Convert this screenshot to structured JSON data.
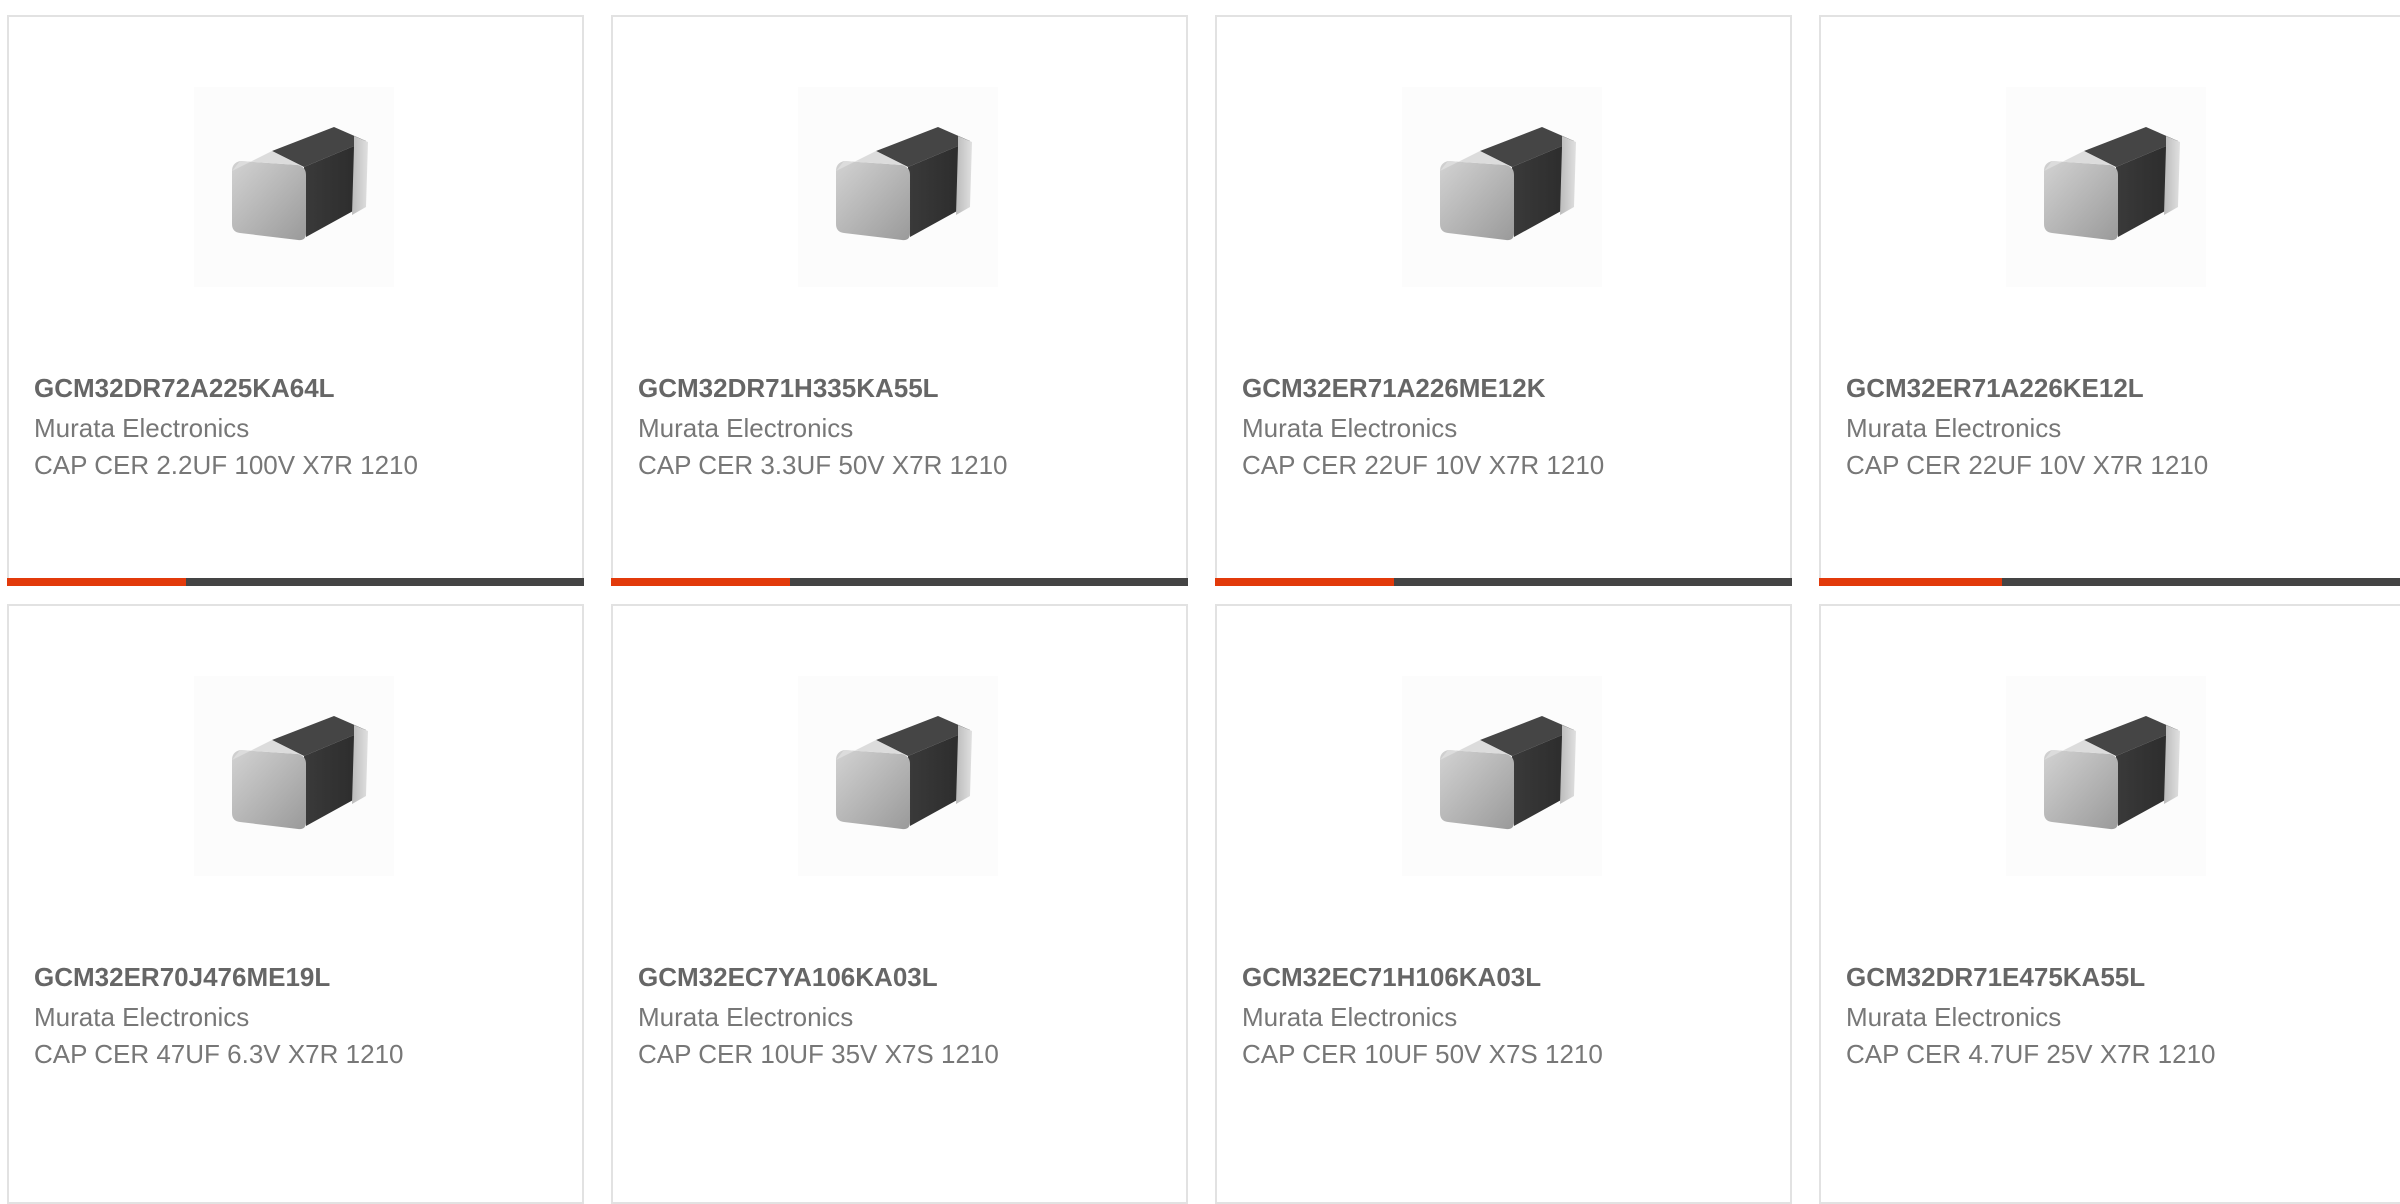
{
  "accent_color": "#e23a0b",
  "bar_track_color": "#444444",
  "products": [
    {
      "part_number": "GCM32DR72A225KA64L",
      "manufacturer": "Murata Electronics",
      "description": "CAP CER 2.2UF 100V X7R 1210",
      "image_icon": "ceramic-capacitor-chip-icon",
      "bar_fill_fraction": 0.31
    },
    {
      "part_number": "GCM32DR71H335KA55L",
      "manufacturer": "Murata Electronics",
      "description": "CAP CER 3.3UF 50V X7R 1210",
      "image_icon": "ceramic-capacitor-chip-icon",
      "bar_fill_fraction": 0.31
    },
    {
      "part_number": "GCM32ER71A226ME12K",
      "manufacturer": "Murata Electronics",
      "description": "CAP CER 22UF 10V X7R 1210",
      "image_icon": "ceramic-capacitor-chip-icon",
      "bar_fill_fraction": 0.31
    },
    {
      "part_number": "GCM32ER71A226KE12L",
      "manufacturer": "Murata Electronics",
      "description": "CAP CER 22UF 10V X7R 1210",
      "image_icon": "ceramic-capacitor-chip-icon",
      "bar_fill_fraction": 0.31
    },
    {
      "part_number": "GCM32ER70J476ME19L",
      "manufacturer": "Murata Electronics",
      "description": "CAP CER 47UF 6.3V X7R 1210",
      "image_icon": "ceramic-capacitor-chip-icon"
    },
    {
      "part_number": "GCM32EC7YA106KA03L",
      "manufacturer": "Murata Electronics",
      "description": "CAP CER 10UF 35V X7S 1210",
      "image_icon": "ceramic-capacitor-chip-icon"
    },
    {
      "part_number": "GCM32EC71H106KA03L",
      "manufacturer": "Murata Electronics",
      "description": "CAP CER 10UF 50V X7S 1210",
      "image_icon": "ceramic-capacitor-chip-icon"
    },
    {
      "part_number": "GCM32DR71E475KA55L",
      "manufacturer": "Murata Electronics",
      "description": "CAP CER 4.7UF 25V X7R 1210",
      "image_icon": "ceramic-capacitor-chip-icon"
    }
  ]
}
